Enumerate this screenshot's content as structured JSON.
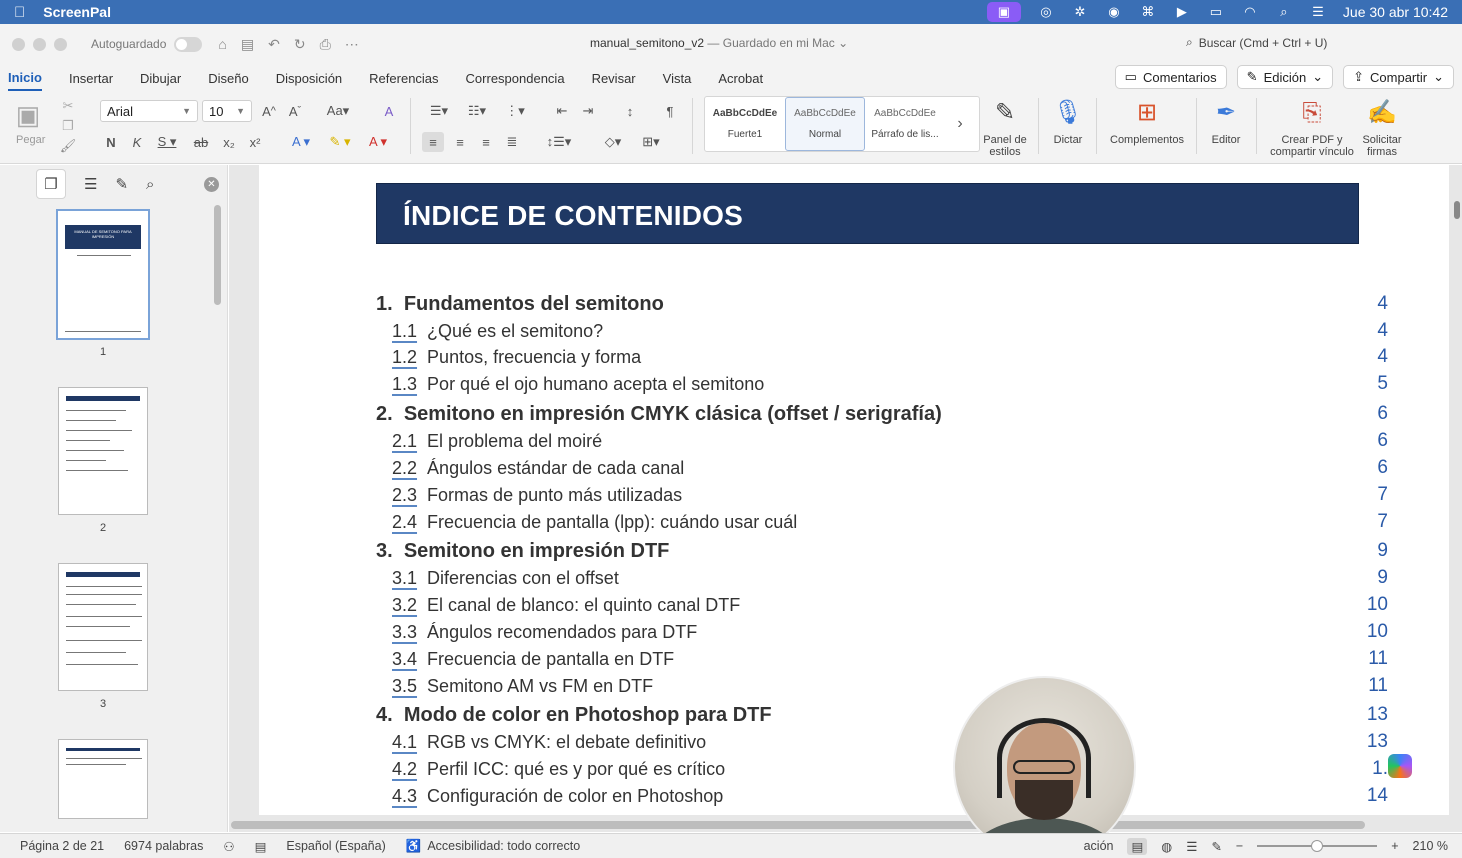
{
  "menubar": {
    "app_name": "ScreenPal",
    "clock": "Jue 30 abr 10:42",
    "icons": [
      "apple-icon",
      "screenpal-icon",
      "creative-cloud-icon",
      "sync-icon",
      "vpn-icon",
      "grid-icon",
      "play-icon",
      "battery-icon",
      "wifi-icon",
      "search-icon",
      "control-center-icon"
    ]
  },
  "titlebar": {
    "autosave_label": "Autoguardado",
    "doc_name": "manual_semitono_v2",
    "doc_status": "— Guardado en mi Mac",
    "search_label": "Buscar (Cmd + Ctrl + U)"
  },
  "tabs": [
    "Inicio",
    "Insertar",
    "Dibujar",
    "Diseño",
    "Disposición",
    "Referencias",
    "Correspondencia",
    "Revisar",
    "Vista",
    "Acrobat"
  ],
  "tab_actions": {
    "comments": "Comentarios",
    "editing": "Edición",
    "share": "Compartir"
  },
  "ribbon": {
    "paste_label": "Pegar",
    "font_name": "Arial",
    "font_size": "10",
    "styles": [
      {
        "sample": "AaBbCcDdEe",
        "name": "Fuerte1"
      },
      {
        "sample": "AaBbCcDdEe",
        "name": "Normal"
      },
      {
        "sample": "AaBbCcDdEe",
        "name": "Párrafo de lis..."
      }
    ],
    "panel_estilos": "Panel de estilos",
    "dictar": "Dictar",
    "complementos": "Complementos",
    "editor": "Editor",
    "crear_pdf": "Crear PDF y compartir vínculo",
    "solicitar_firmas": "Solicitar firmas"
  },
  "navpane": {
    "thumbnails": [
      {
        "page": "1",
        "title": "MANUAL DE SEMITONO PARA IMPRESIÓN"
      },
      {
        "page": "2"
      },
      {
        "page": "3"
      }
    ]
  },
  "toc": {
    "title": "ÍNDICE DE CONTENIDOS",
    "entries": [
      {
        "level": 1,
        "num": "1.",
        "text": "Fundamentos del semitono",
        "page": "4"
      },
      {
        "level": 2,
        "num": "1.1",
        "text": "¿Qué es el semitono?",
        "page": "4"
      },
      {
        "level": 2,
        "num": "1.2",
        "text": "Puntos, frecuencia y forma",
        "page": "4"
      },
      {
        "level": 2,
        "num": "1.3",
        "text": "Por qué el ojo humano acepta el semitono",
        "page": "5"
      },
      {
        "level": 1,
        "num": "2.",
        "text": "Semitono en impresión CMYK clásica (offset / serigrafía)",
        "page": "6"
      },
      {
        "level": 2,
        "num": "2.1",
        "text": "El problema del moiré",
        "page": "6"
      },
      {
        "level": 2,
        "num": "2.2",
        "text": "Ángulos estándar de cada canal",
        "page": "6"
      },
      {
        "level": 2,
        "num": "2.3",
        "text": "Formas de punto más utilizadas",
        "page": "7"
      },
      {
        "level": 2,
        "num": "2.4",
        "text": "Frecuencia de pantalla (lpp): cuándo usar cuál",
        "page": "7"
      },
      {
        "level": 1,
        "num": "3.",
        "text": "Semitono en impresión DTF",
        "page": "9"
      },
      {
        "level": 2,
        "num": "3.1",
        "text": "Diferencias con el offset",
        "page": "9"
      },
      {
        "level": 2,
        "num": "3.2",
        "text": "El canal de blanco: el quinto canal DTF",
        "page": "10"
      },
      {
        "level": 2,
        "num": "3.3",
        "text": "Ángulos recomendados para DTF",
        "page": "10"
      },
      {
        "level": 2,
        "num": "3.4",
        "text": "Frecuencia de pantalla en DTF",
        "page": "11"
      },
      {
        "level": 2,
        "num": "3.5",
        "text": "Semitono AM vs FM en DTF",
        "page": "11"
      },
      {
        "level": 1,
        "num": "4.",
        "text": "Modo de color en Photoshop para DTF",
        "page": "13"
      },
      {
        "level": 2,
        "num": "4.1",
        "text": "RGB vs CMYK: el debate definitivo",
        "page": "13"
      },
      {
        "level": 2,
        "num": "4.2",
        "text": "Perfil ICC: qué es y por qué es crítico",
        "page": "1."
      },
      {
        "level": 2,
        "num": "4.3",
        "text": "Configuración de color en Photoshop",
        "page": "14"
      }
    ]
  },
  "statusbar": {
    "page": "Página 2 de 21",
    "words": "6974 palabras",
    "language": "Español (España)",
    "accessibility": "Accesibilidad: todo correcto",
    "focus": "ación",
    "zoom": "210 %"
  }
}
